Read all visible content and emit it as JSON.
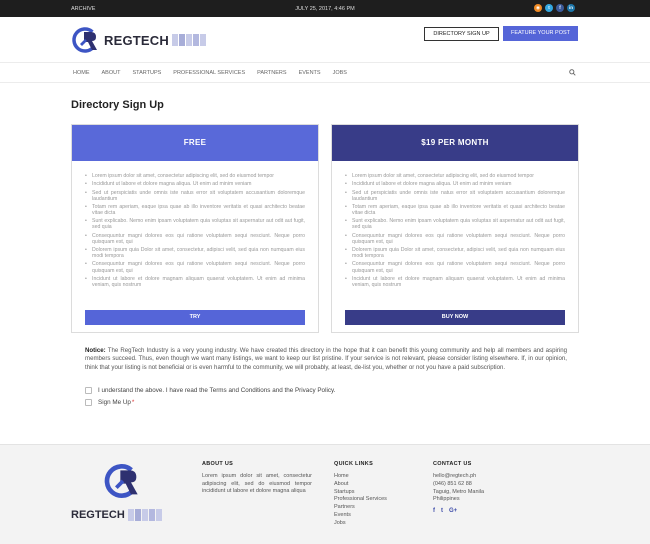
{
  "topbar": {
    "archive": "ARCHIVE",
    "datetime": "JULY 25, 2017, 4:46 PM",
    "social": [
      {
        "icon": "rss-icon",
        "glyph": "◉",
        "color": "#f08a24"
      },
      {
        "icon": "twitter-icon",
        "glyph": "t",
        "color": "#33a7e0"
      },
      {
        "icon": "facebook-icon",
        "glyph": "f",
        "color": "#3b5a9a"
      },
      {
        "icon": "linkedin-icon",
        "glyph": "in",
        "color": "#1b75a8"
      }
    ]
  },
  "header": {
    "logo_word": "REGTECH",
    "directory_signup": "DIRECTORY SIGN UP",
    "feature_post": "FEATURE YOUR POST"
  },
  "nav": {
    "items": [
      "HOME",
      "ABOUT",
      "STARTUPS",
      "PROFESSIONAL SERVICES",
      "PARTNERS",
      "EVENTS",
      "JOBS"
    ]
  },
  "page_title": "Directory Sign Up",
  "plans": [
    {
      "title": "FREE",
      "button": "TRY",
      "features": [
        "Lorem ipsum dolor sit amet, consectetur adipiscing elit, sed do eiusmod tempor",
        "Incididunt ut labore et dolore magna aliqua. Ut enim ad minim veniam",
        "Sed ut perspiciatis unde omnis iste natus error sit voluptatem accusantium doloremque laudantium",
        "Totam rem aperiam, eaque ipsa quae ab illo inventore veritatis et quasi architecto beatae vitae dicta",
        "Sunt explicabo. Nemo enim ipsam voluptatem quia voluptas sit aspernatur aut odit aut fugit, sed quia",
        "Consequuntur magni dolores eos qui ratione voluptatem sequi nesciunt. Neque porro quisquam est, qui",
        "Dolorem ipsum quia Dolor sit amet, consectetur, adipisci velit, sed quia non numquam eius modi tempora",
        "Consequuntur magni dolores eos qui ratione voluptatem sequi nesciunt. Neque porro quisquam est, qui",
        "Incidunt ut labore et dolore magnam aliquam quaerat voluptatem. Ut enim ad minima veniam, quis nostrum"
      ]
    },
    {
      "title": "$19 PER MONTH",
      "button": "BUY NOW",
      "features": [
        "Lorem ipsum dolor sit amet, consectetur adipiscing elit, sed do eiusmod tempor",
        "Incididunt ut labore et dolore magna aliqua. Ut enim ad minim veniam",
        "Sed ut perspiciatis unde omnis iste natus error sit voluptatem accusantium doloremque laudantium",
        "Totam rem aperiam, eaque ipsa quae ab illo inventore veritatis et quasi architecto beatae vitae dicta",
        "Sunt explicabo. Nemo enim ipsam voluptatem quia voluptas sit aspernatur aut odit aut fugit, sed quia",
        "Consequuntur magni dolores eos qui ratione voluptatem sequi nesciunt. Neque porro quisquam est, qui",
        "Dolorem ipsum quia Dolor sit amet, consectetur, adipisci velit, sed quia non numquam eius modi tempora",
        "Consequuntur magni dolores eos qui ratione voluptatem sequi nesciunt. Neque porro quisquam est, qui",
        "Incidunt ut labore et dolore magnam aliquam quaerat voluptatem. Ut enim ad minima veniam, quis nostrum"
      ]
    }
  ],
  "notice": {
    "label": "Notice:",
    "text": " The RegTech Industry is a very young industry. We have created this directory in the hope that it can benefit this young community and help all members and aspiring members succeed. Thus, even though we want many listings, we want to keep our list pristine. If your service is not relevant, please consider listing elsewhere. If, in our opinion, think that your listing is not beneficial or is even harmful to the community, we will probably, at least, de-list you, whether or not you have a paid subscription."
  },
  "checks": {
    "agree": "I understand the above. I have read the Terms and Conditions and the Privacy Policy.",
    "signup": "Sign Me Up",
    "required_mark": "*"
  },
  "footer": {
    "logo_word": "REGTECH",
    "about_title": "ABOUT US",
    "about_text": "Lorem ipsum dolor sit amet, consectetur adipiscing elit, sed do eiusmod tempor incididunt ut labore et dolore magna aliqua",
    "links_title": "QUICK LINKS",
    "links": [
      "Home",
      "About",
      "Startups",
      "Professional Services",
      "Partners",
      "Events",
      "Jobs"
    ],
    "contact_title": "CONTACT US",
    "contact": [
      "hello@regtech.ph",
      "(046) 851 62 88",
      "Taguig, Metro Manila",
      "Philippines"
    ],
    "social": [
      "f",
      "t",
      "G+"
    ]
  },
  "colors": {
    "accent": "#5565d8",
    "accent_dark": "#383c88",
    "topbar": "#1e1e1e"
  }
}
